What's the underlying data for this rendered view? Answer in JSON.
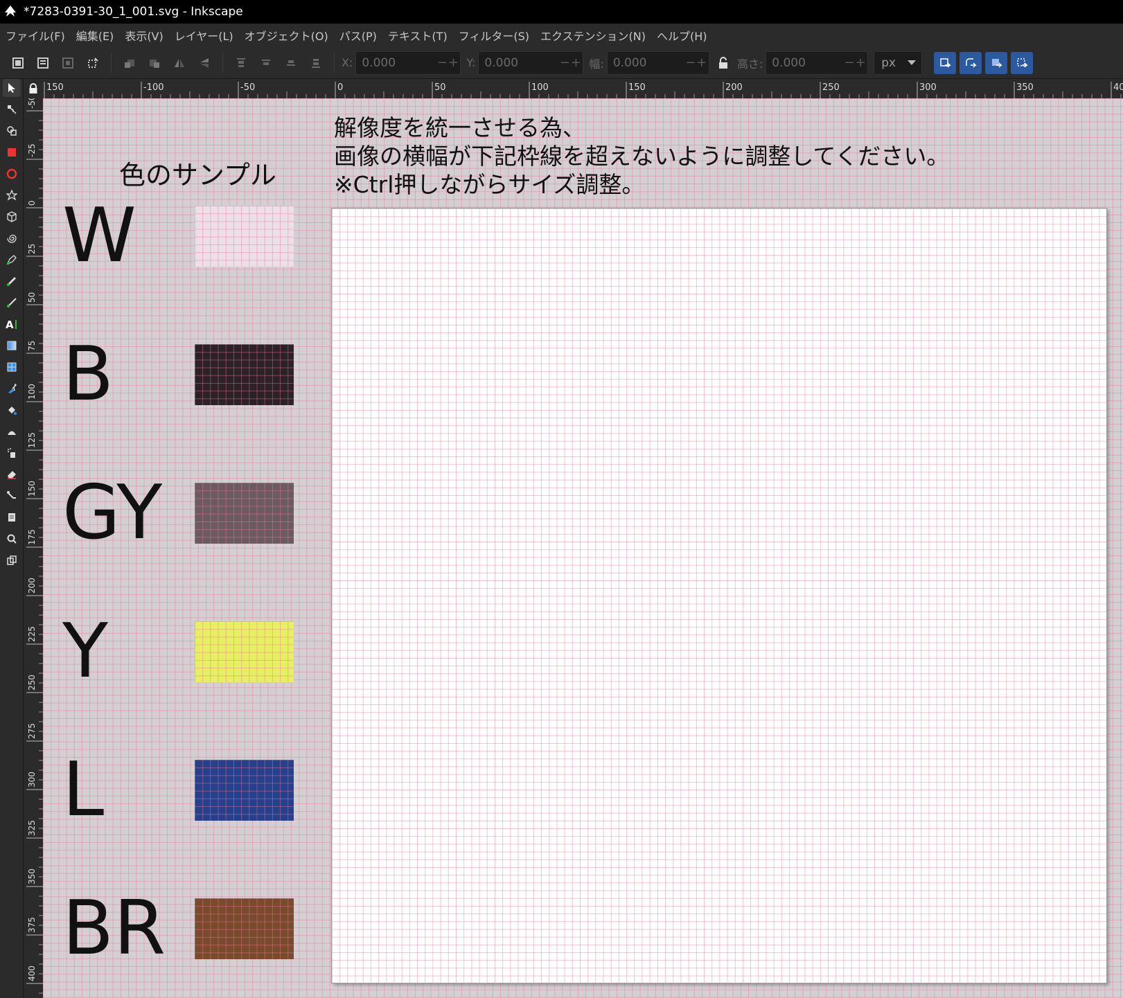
{
  "window": {
    "title": "*7283-0391-30_1_001.svg - Inkscape"
  },
  "menu": {
    "items": [
      "ファイル(F)",
      "編集(E)",
      "表示(V)",
      "レイヤー(L)",
      "オブジェクト(O)",
      "パス(P)",
      "テキスト(T)",
      "フィルター(S)",
      "エクステンション(N)",
      "ヘルプ(H)"
    ]
  },
  "toolbar": {
    "x_label": "X:",
    "x_value": "0.000",
    "y_label": "Y:",
    "y_value": "0.000",
    "w_label": "幅:",
    "w_value": "0.000",
    "h_label": "高さ:",
    "h_value": "0.000",
    "unit": "px"
  },
  "rulers": {
    "horizontal_labels": [
      "150",
      "-100",
      "-50",
      "0",
      "50",
      "100",
      "150",
      "200",
      "250",
      "300",
      "350",
      "400"
    ],
    "vertical_labels": [
      "-50",
      "-25",
      "0",
      "25",
      "50",
      "75",
      "100",
      "125",
      "150",
      "175",
      "200",
      "225",
      "250",
      "275",
      "300",
      "325",
      "350",
      "375",
      "400"
    ]
  },
  "canvas": {
    "sample_title": "色のサンプル",
    "instructions": [
      "解像度を統一させる為、",
      "画像の横幅が下記枠線を超えないように調整してください。",
      "※Ctrl押しながらサイズ調整。"
    ],
    "swatches": [
      {
        "code": "W",
        "color": "#ecdfe8"
      },
      {
        "code": "B",
        "color": "#2b2126"
      },
      {
        "code": "GY",
        "color": "#6c5a61"
      },
      {
        "code": "Y",
        "color": "#e6f062"
      },
      {
        "code": "L",
        "color": "#27408b"
      },
      {
        "code": "BR",
        "color": "#7a4a2c"
      }
    ]
  },
  "colors": {
    "grid": "#eb7896",
    "canvas_bg": "#d3cfd2",
    "accent": "#2c5aa0"
  }
}
